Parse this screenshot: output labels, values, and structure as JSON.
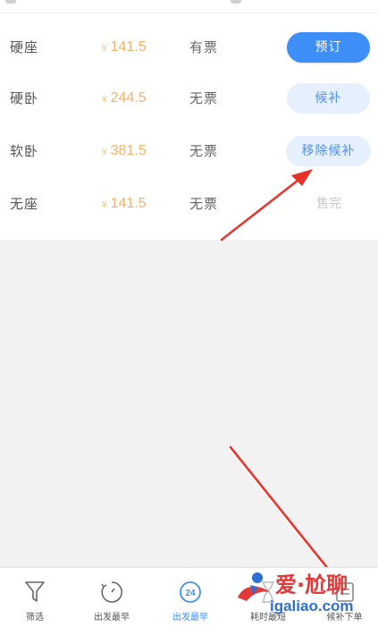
{
  "seats": [
    {
      "class": "硬座",
      "price": "141.5",
      "status": "有票",
      "action": "预订",
      "action_type": "primary"
    },
    {
      "class": "硬卧",
      "price": "244.5",
      "status": "无票",
      "action": "候补",
      "action_type": "soft"
    },
    {
      "class": "软卧",
      "price": "381.5",
      "status": "无票",
      "action": "移除候补",
      "action_type": "soft"
    },
    {
      "class": "无座",
      "price": "141.5",
      "status": "无票",
      "action": "售完",
      "action_type": "disabled"
    }
  ],
  "currency_symbol": "¥",
  "tabs": [
    {
      "label": "筛选",
      "icon": "filter-icon"
    },
    {
      "label": "出发最早",
      "icon": "clock-icon"
    },
    {
      "label": "出发最早",
      "icon": "24h-icon",
      "active": true
    },
    {
      "label": "耗时最短",
      "icon": "hourglass-icon"
    },
    {
      "label": "候补下单",
      "icon": "order-icon"
    }
  ],
  "icon_24_text": "24",
  "watermark": {
    "title": "爱·尬聊",
    "url": "igaliao.com"
  },
  "colors": {
    "primary": "#3d8ef6",
    "price": "#f5b26b",
    "soft_button": "#e6f0fd",
    "annotation_arrow": "#e8322b"
  }
}
